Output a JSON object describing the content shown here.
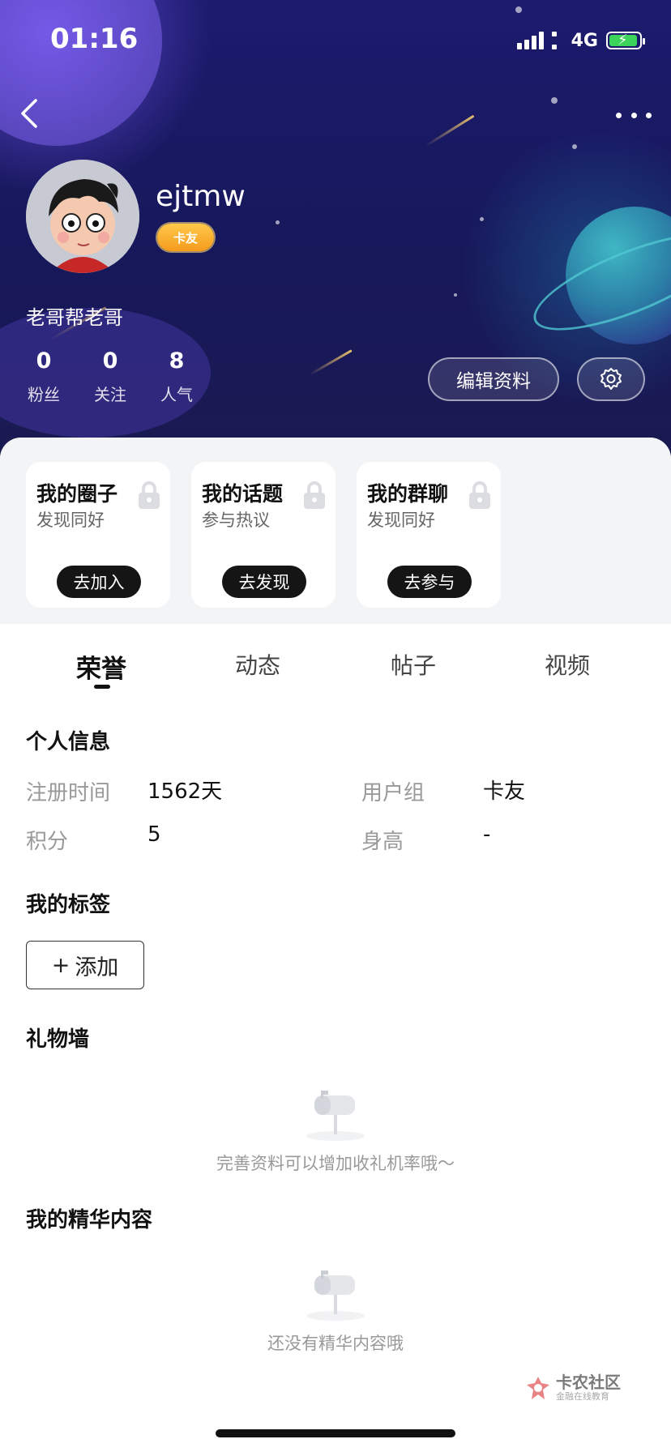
{
  "status_bar": {
    "time": "01:16",
    "network": "4G"
  },
  "profile": {
    "username": "ejtmw",
    "badge": "卡友",
    "bio": "老哥帮老哥",
    "stats": [
      {
        "value": "0",
        "label": "粉丝"
      },
      {
        "value": "0",
        "label": "关注"
      },
      {
        "value": "8",
        "label": "人气"
      }
    ],
    "edit_label": "编辑资料"
  },
  "cards": [
    {
      "title": "我的圈子",
      "subtitle": "发现同好",
      "button": "去加入"
    },
    {
      "title": "我的话题",
      "subtitle": "参与热议",
      "button": "去发现"
    },
    {
      "title": "我的群聊",
      "subtitle": "发现同好",
      "button": "去参与"
    }
  ],
  "tabs": [
    {
      "label": "荣誉",
      "active": true
    },
    {
      "label": "动态",
      "active": false
    },
    {
      "label": "帖子",
      "active": false
    },
    {
      "label": "视频",
      "active": false
    }
  ],
  "personal_info": {
    "title": "个人信息",
    "fields": [
      {
        "label": "注册时间",
        "value": "1562天"
      },
      {
        "label": "用户组",
        "value": "卡友"
      },
      {
        "label": "积分",
        "value": "5"
      },
      {
        "label": "身高",
        "value": "-"
      }
    ]
  },
  "tags": {
    "title": "我的标签",
    "add_label": "添加",
    "add_symbol": "+"
  },
  "gift_wall": {
    "title": "礼物墙",
    "empty_text": "完善资料可以增加收礼机率哦～"
  },
  "featured": {
    "title": "我的精华内容",
    "empty_text": "还没有精华内容哦"
  },
  "watermark": {
    "main": "卡农社区",
    "sub": "金融在线教育"
  },
  "colors": {
    "header_bg": "#1c1b6e",
    "battery": "#3bd35a",
    "badge": "#f59b1c",
    "button_dark": "#151515"
  }
}
